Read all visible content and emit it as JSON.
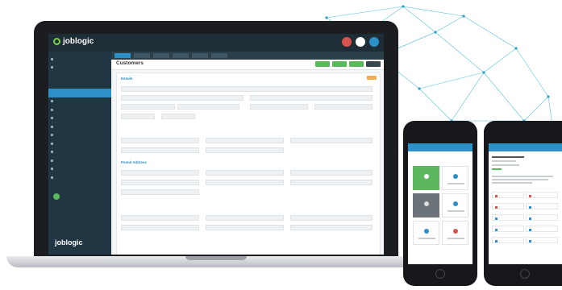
{
  "app": {
    "logo_text": "joblogic",
    "sidebar_logo_text": "joblogic",
    "page_title": "Customers",
    "section_details": "Details",
    "section_postal": "Postal Address"
  },
  "colors": {
    "accent_blue": "#2d91c9",
    "sidebar_bg": "#203642",
    "success_green": "#5cb85c",
    "warning_orange": "#f0ad4e",
    "alert_red": "#d9534f"
  },
  "icons": {
    "bell": "bell-icon",
    "help": "help-icon",
    "user": "user-avatar-icon"
  }
}
